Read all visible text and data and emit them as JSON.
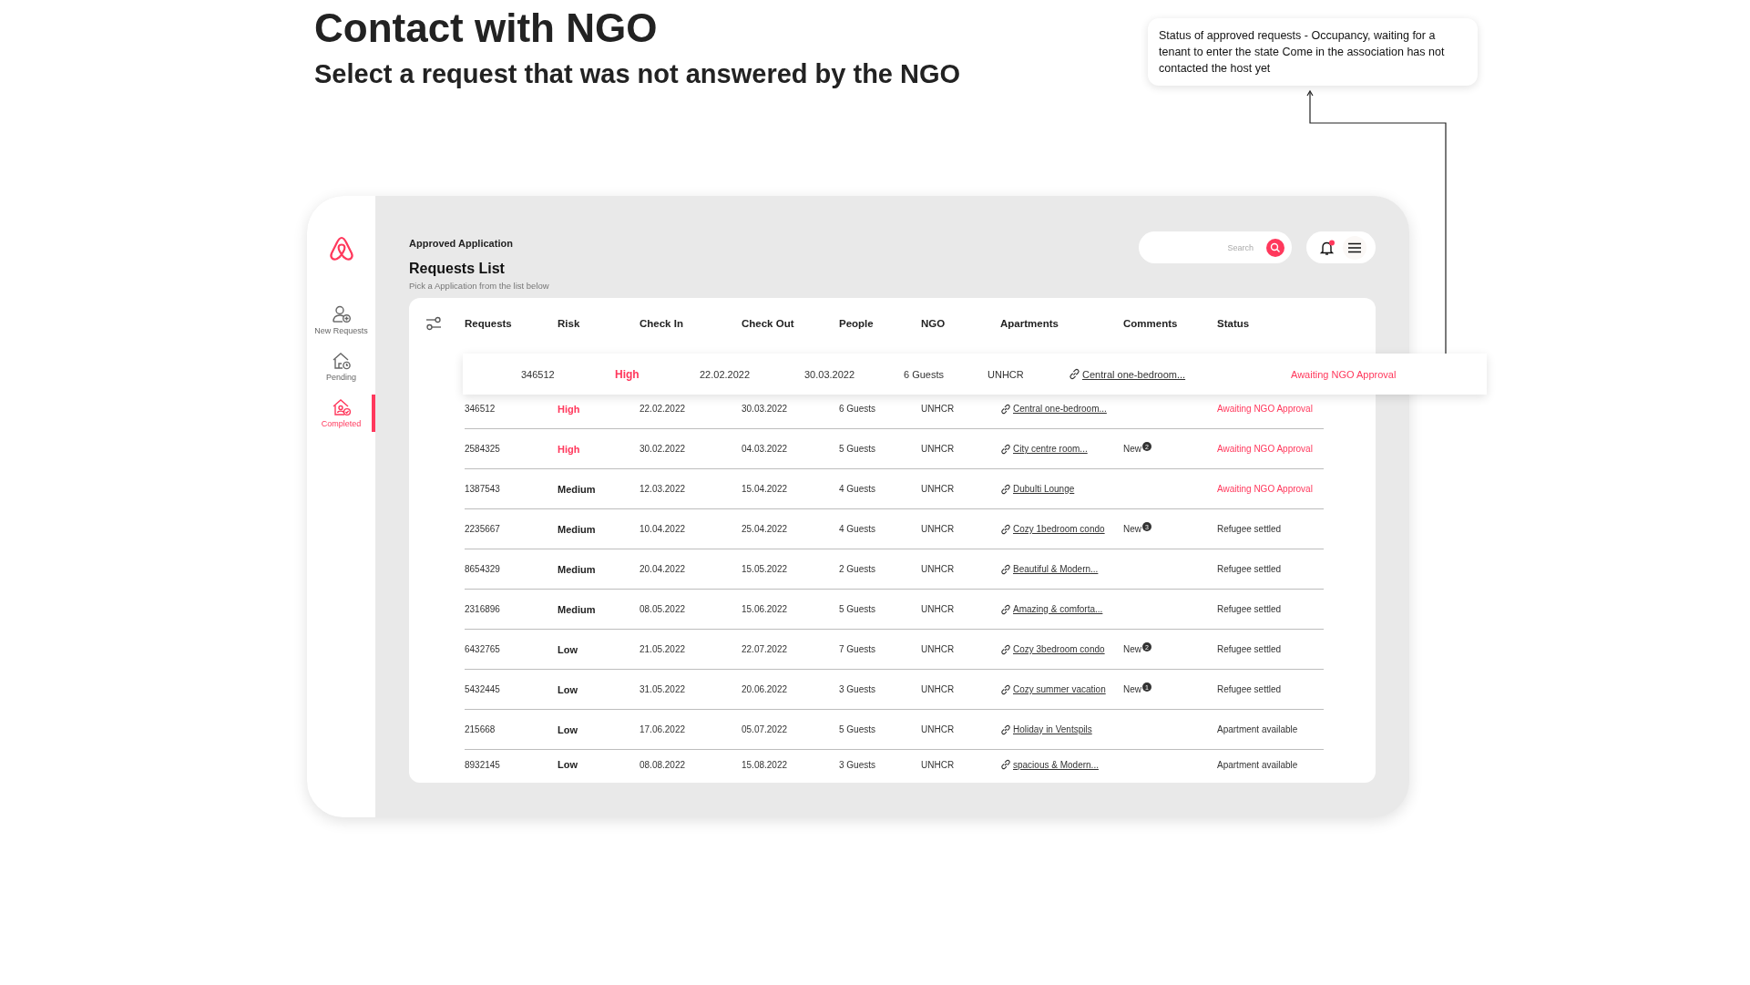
{
  "page": {
    "title": "Contact with NGO",
    "subtitle": "Select a request that was not answered by the NGO"
  },
  "annotation": {
    "text": "Status of approved requests - Occupancy, waiting for a tenant to enter the state Come in the association has not contacted the host yet"
  },
  "sidebar": {
    "items": [
      {
        "label": "New Requests",
        "kind": "new",
        "selected": false
      },
      {
        "label": "Pending",
        "kind": "pending",
        "selected": false
      },
      {
        "label": "Completed",
        "kind": "completed",
        "selected": true
      }
    ]
  },
  "header": {
    "breadcrumb": "Approved Application",
    "title": "Requests List",
    "subtitle": "Pick a Application from the list below",
    "search": {
      "placeholder": "Search"
    },
    "has_unread": true
  },
  "table": {
    "columns": [
      "Requests",
      "Risk",
      "Check In",
      "Check Out",
      "People",
      "NGO",
      "Apartments",
      "Comments",
      "Status"
    ],
    "highlighted_row": {
      "request": "346512",
      "risk": "High",
      "risk_high": true,
      "check_in": "22.02.2022",
      "check_out": "30.03.2022",
      "people": "6 Guests",
      "ngo": "UNHCR",
      "apartment": "Central one-bedroom...",
      "status": "Awaiting NGO Approval",
      "status_pending": true
    },
    "rows": [
      {
        "request": "346512",
        "risk": "High",
        "risk_high": true,
        "check_in": "22.02.2022",
        "check_out": "30.03.2022",
        "people": "6 Guests",
        "ngo": "UNHCR",
        "apartment": "Central one-bedroom...",
        "status": "Awaiting NGO Approval",
        "status_pending": true
      },
      {
        "request": "2584325",
        "risk": "High",
        "risk_high": true,
        "check_in": "30.02.2022",
        "check_out": "04.03.2022",
        "people": "5 Guests",
        "ngo": "UNHCR",
        "apartment": "City centre room...",
        "comment": "New",
        "comment_count": "2",
        "status": "Awaiting NGO Approval",
        "status_pending": true
      },
      {
        "request": "1387543",
        "risk": "Medium",
        "risk_high": false,
        "check_in": "12.03.2022",
        "check_out": "15.04.2022",
        "people": "4 Guests",
        "ngo": "UNHCR",
        "apartment": "Dubulti Lounge",
        "status": "Awaiting NGO Approval",
        "status_pending": true
      },
      {
        "request": "2235667",
        "risk": "Medium",
        "risk_high": false,
        "check_in": "10.04.2022",
        "check_out": "25.04.2022",
        "people": "4 Guests",
        "ngo": "UNHCR",
        "apartment": "Cozy 1bedroom condo",
        "comment": "New",
        "comment_count": "3",
        "status": "Refugee settled",
        "status_pending": false
      },
      {
        "request": "8654329",
        "risk": "Medium",
        "risk_high": false,
        "check_in": "20.04.2022",
        "check_out": "15.05.2022",
        "people": "2 Guests",
        "ngo": "UNHCR",
        "apartment": "Beautiful & Modern...",
        "status": "Refugee settled",
        "status_pending": false
      },
      {
        "request": "2316896",
        "risk": "Medium",
        "risk_high": false,
        "check_in": "08.05.2022",
        "check_out": "15.06.2022",
        "people": "5 Guests",
        "ngo": "UNHCR",
        "apartment": "Amazing & comforta...",
        "status": "Refugee settled",
        "status_pending": false
      },
      {
        "request": "6432765",
        "risk": "Low",
        "risk_high": false,
        "check_in": "21.05.2022",
        "check_out": "22.07.2022",
        "people": "7 Guests",
        "ngo": "UNHCR",
        "apartment": "Cozy 3bedroom condo",
        "comment": "New",
        "comment_count": "2",
        "status": "Refugee settled",
        "status_pending": false
      },
      {
        "request": "5432445",
        "risk": "Low",
        "risk_high": false,
        "check_in": "31.05.2022",
        "check_out": "20.06.2022",
        "people": "3 Guests",
        "ngo": "UNHCR",
        "apartment": "Cozy summer vacation",
        "comment": "New",
        "comment_count": "1",
        "status": "Refugee settled",
        "status_pending": false
      },
      {
        "request": "215668",
        "risk": "Low",
        "risk_high": false,
        "check_in": "17.06.2022",
        "check_out": "05.07.2022",
        "people": "5 Guests",
        "ngo": "UNHCR",
        "apartment": "Holiday in Ventspils",
        "status": "Apartment available",
        "status_pending": false
      },
      {
        "request": "8932145",
        "risk": "Low",
        "risk_high": false,
        "check_in": "08.08.2022",
        "check_out": "15.08.2022",
        "people": "3 Guests",
        "ngo": "UNHCR",
        "apartment": "spacious & Modern...",
        "status": "Apartment available",
        "status_pending": false
      }
    ]
  }
}
